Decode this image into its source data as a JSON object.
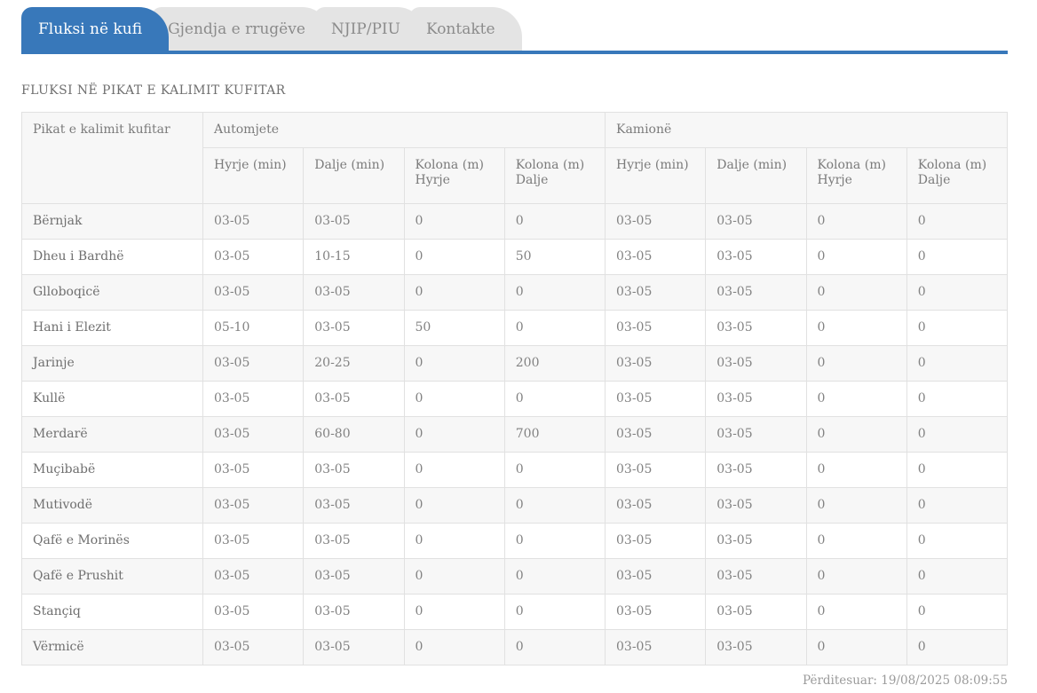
{
  "tabs": [
    {
      "label": "Fluksi në kufi",
      "active": true
    },
    {
      "label": "Gjendja e rrugëve",
      "active": false
    },
    {
      "label": "NJIP/PIU",
      "active": false
    },
    {
      "label": "Kontakte",
      "active": false
    }
  ],
  "page_title": "FLUKSI NË PIKAT E KALIMIT KUFITAR",
  "table": {
    "col1_header": "Pikat e kalimit kufitar",
    "groups": [
      {
        "label": "Automjete",
        "subheaders": [
          "Hyrje (min)",
          "Dalje (min)",
          "Kolona (m) Hyrje",
          "Kolona (m) Dalje"
        ]
      },
      {
        "label": "Kamionë",
        "subheaders": [
          "Hyrje (min)",
          "Dalje (min)",
          "Kolona (m) Hyrje",
          "Kolona (m) Dalje"
        ]
      }
    ],
    "rows": [
      {
        "name": "Bërnjak",
        "values": [
          "03-05",
          "03-05",
          "0",
          "0",
          "03-05",
          "03-05",
          "0",
          "0"
        ]
      },
      {
        "name": "Dheu i Bardhë",
        "values": [
          "03-05",
          "10-15",
          "0",
          "50",
          "03-05",
          "03-05",
          "0",
          "0"
        ]
      },
      {
        "name": "Glloboqicë",
        "values": [
          "03-05",
          "03-05",
          "0",
          "0",
          "03-05",
          "03-05",
          "0",
          "0"
        ]
      },
      {
        "name": "Hani i Elezit",
        "values": [
          "05-10",
          "03-05",
          "50",
          "0",
          "03-05",
          "03-05",
          "0",
          "0"
        ]
      },
      {
        "name": "Jarinje",
        "values": [
          "03-05",
          "20-25",
          "0",
          "200",
          "03-05",
          "03-05",
          "0",
          "0"
        ]
      },
      {
        "name": "Kullë",
        "values": [
          "03-05",
          "03-05",
          "0",
          "0",
          "03-05",
          "03-05",
          "0",
          "0"
        ]
      },
      {
        "name": "Merdarë",
        "values": [
          "03-05",
          "60-80",
          "0",
          "700",
          "03-05",
          "03-05",
          "0",
          "0"
        ]
      },
      {
        "name": "Muçibabë",
        "values": [
          "03-05",
          "03-05",
          "0",
          "0",
          "03-05",
          "03-05",
          "0",
          "0"
        ]
      },
      {
        "name": "Mutivodë",
        "values": [
          "03-05",
          "03-05",
          "0",
          "0",
          "03-05",
          "03-05",
          "0",
          "0"
        ]
      },
      {
        "name": "Qafë e Morinës",
        "values": [
          "03-05",
          "03-05",
          "0",
          "0",
          "03-05",
          "03-05",
          "0",
          "0"
        ]
      },
      {
        "name": "Qafë e Prushit",
        "values": [
          "03-05",
          "03-05",
          "0",
          "0",
          "03-05",
          "03-05",
          "0",
          "0"
        ]
      },
      {
        "name": "Stançiq",
        "values": [
          "03-05",
          "03-05",
          "0",
          "0",
          "03-05",
          "03-05",
          "0",
          "0"
        ]
      },
      {
        "name": "Vërmicë",
        "values": [
          "03-05",
          "03-05",
          "0",
          "0",
          "03-05",
          "03-05",
          "0",
          "0"
        ]
      }
    ]
  },
  "footer": {
    "updated": "Përditesuar: 19/08/2025 08:09:55"
  },
  "colors": {
    "accent": "#3878ba",
    "tab_inactive_bg": "#e4e4e4",
    "table_border": "#e1e1e1",
    "header_bg": "#f7f7f7",
    "stripe_bg": "#f7f7f7"
  }
}
